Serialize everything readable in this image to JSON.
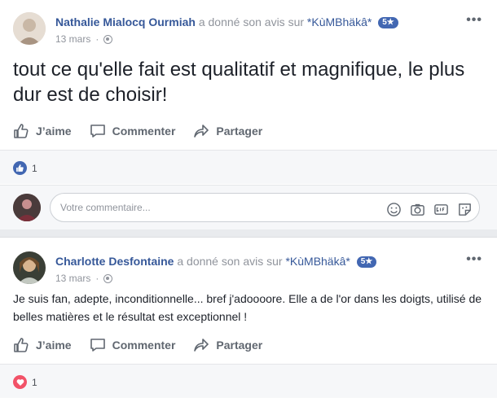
{
  "posts": [
    {
      "author": "Nathalie Mialocq Ourmiah",
      "action": "a donné son avis sur",
      "page": "*KùMBhäkâ*",
      "rating": "5★",
      "date": "13 mars",
      "text": "tout ce qu'elle fait est qualitatif et magnifique, le plus dur est de choisir!",
      "reaction_count": "1",
      "reaction_type": "like-icon"
    },
    {
      "author": "Charlotte Desfontaine",
      "action": "a donné son avis sur",
      "page": "*KùMBhäkâ*",
      "rating": "5★",
      "date": "13 mars",
      "text": "Je suis fan, adepte, inconditionnelle... bref j'adoooore. Elle a de l'or dans les doigts, utilisé de belles matières et le résultat est exceptionnel !",
      "reaction_count": "1",
      "reaction_type": "heart-icon"
    }
  ],
  "actions": {
    "like": "J’aime",
    "comment": "Commenter",
    "share": "Partager"
  },
  "comment_box": {
    "placeholder": "Votre commentaire..."
  },
  "more_glyph": "•••",
  "colors": {
    "link_blue": "#365899",
    "badge_blue": "#4267b2",
    "love_red": "#f25268"
  }
}
